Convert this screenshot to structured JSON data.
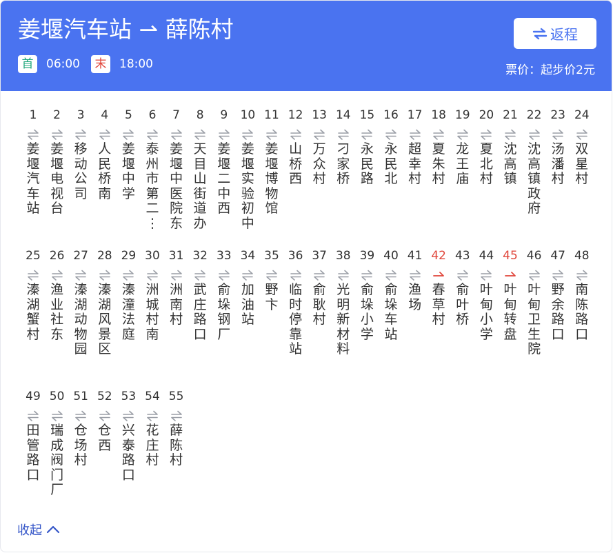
{
  "header": {
    "title": "姜堰汽车站 ⇀ 薛陈村",
    "first_label": "首",
    "first_time": "06:00",
    "last_label": "末",
    "last_time": "18:00",
    "return_label": "返程",
    "price": "票价：起步价2元",
    "accent_color": "#4a73f0"
  },
  "stops": [
    {
      "n": "1",
      "name": "姜堰汽车站"
    },
    {
      "n": "2",
      "name": "姜堰电视台"
    },
    {
      "n": "3",
      "name": "移动公司"
    },
    {
      "n": "4",
      "name": "人民桥南"
    },
    {
      "n": "5",
      "name": "姜堰中学"
    },
    {
      "n": "6",
      "name": "泰州市第二⋮"
    },
    {
      "n": "7",
      "name": "姜堰中医院东"
    },
    {
      "n": "8",
      "name": "天目山街道办"
    },
    {
      "n": "9",
      "name": "姜堰二中西"
    },
    {
      "n": "10",
      "name": "姜堰实验初中"
    },
    {
      "n": "11",
      "name": "姜堰博物馆"
    },
    {
      "n": "12",
      "name": "山桥西"
    },
    {
      "n": "13",
      "name": "万众村"
    },
    {
      "n": "14",
      "name": "刁家桥"
    },
    {
      "n": "15",
      "name": "永民路"
    },
    {
      "n": "16",
      "name": "永民北"
    },
    {
      "n": "17",
      "name": "超幸村"
    },
    {
      "n": "18",
      "name": "夏朱村"
    },
    {
      "n": "19",
      "name": "龙王庙"
    },
    {
      "n": "20",
      "name": "夏北村"
    },
    {
      "n": "21",
      "name": "沈高镇"
    },
    {
      "n": "22",
      "name": "沈高镇政府"
    },
    {
      "n": "23",
      "name": "汤潘村"
    },
    {
      "n": "24",
      "name": "双星村"
    },
    {
      "n": "25",
      "name": "溱湖蟹村"
    },
    {
      "n": "26",
      "name": "渔业社东"
    },
    {
      "n": "27",
      "name": "溱湖动物园"
    },
    {
      "n": "28",
      "name": "溱湖风景区"
    },
    {
      "n": "29",
      "name": "溱潼法庭"
    },
    {
      "n": "30",
      "name": "洲城村南"
    },
    {
      "n": "31",
      "name": "洲南村"
    },
    {
      "n": "32",
      "name": "武庄路口"
    },
    {
      "n": "33",
      "name": "俞垛钢厂"
    },
    {
      "n": "34",
      "name": "加油站"
    },
    {
      "n": "35",
      "name": "野卞"
    },
    {
      "n": "36",
      "name": "临时停靠站"
    },
    {
      "n": "37",
      "name": "俞耿村"
    },
    {
      "n": "38",
      "name": "光明新材料"
    },
    {
      "n": "39",
      "name": "俞垛小学"
    },
    {
      "n": "40",
      "name": "俞垛车站"
    },
    {
      "n": "41",
      "name": "渔场"
    },
    {
      "n": "42",
      "name": "春草村",
      "oneway": true
    },
    {
      "n": "43",
      "name": "俞叶桥"
    },
    {
      "n": "44",
      "name": "叶甸小学"
    },
    {
      "n": "45",
      "name": "叶甸转盘",
      "oneway": true
    },
    {
      "n": "46",
      "name": "叶甸卫生院"
    },
    {
      "n": "47",
      "name": "野余路口"
    },
    {
      "n": "48",
      "name": "南陈路口"
    },
    {
      "n": "49",
      "name": "田管路口"
    },
    {
      "n": "50",
      "name": "瑞成阀门厂"
    },
    {
      "n": "51",
      "name": "仓场村"
    },
    {
      "n": "52",
      "name": "仓西"
    },
    {
      "n": "53",
      "name": "兴泰路口"
    },
    {
      "n": "54",
      "name": "花庄村"
    },
    {
      "n": "55",
      "name": "薛陈村"
    }
  ],
  "collapse_label": "收起",
  "icons": {
    "bidirectional": "two-way-arrow-icon",
    "oneway": "one-way-arrow-icon",
    "return": "swap-icon",
    "collapse": "chevron-up-icon"
  },
  "colors": {
    "oneway_highlight": "#e0463b",
    "two_way_arrow": "#9a9ea6",
    "link": "#3556c8"
  }
}
